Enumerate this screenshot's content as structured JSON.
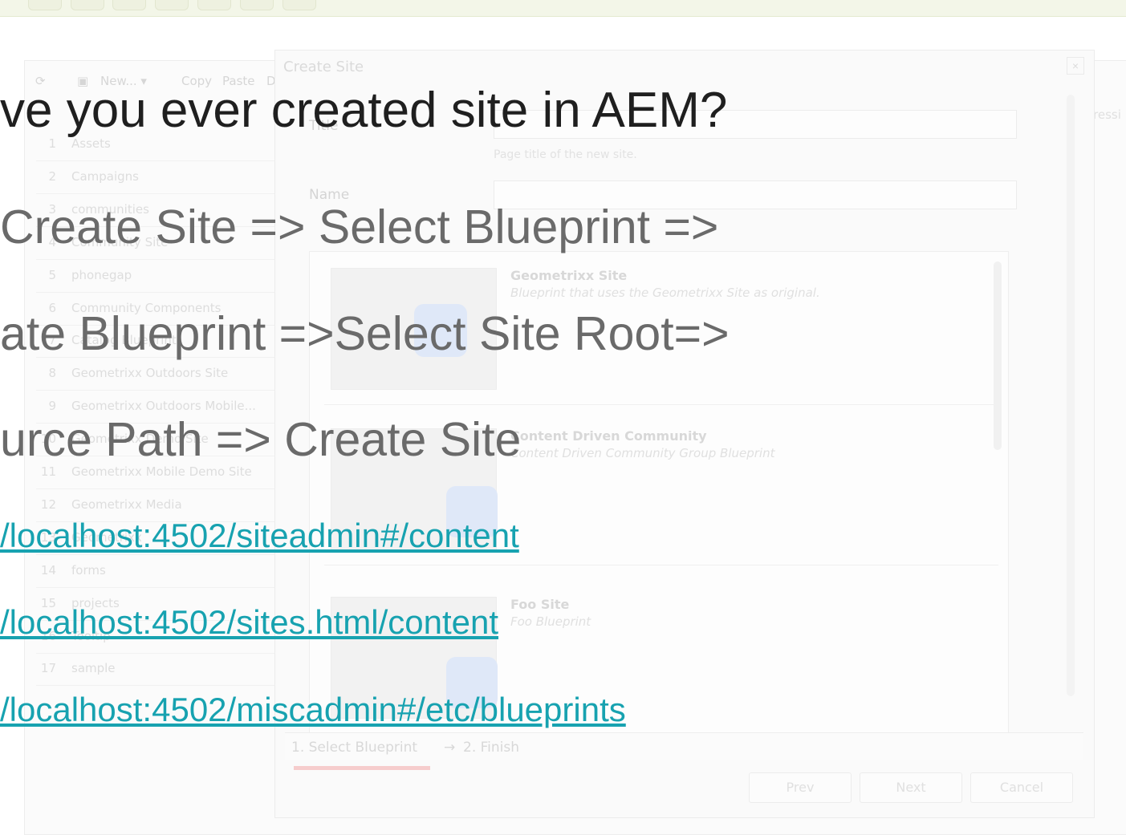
{
  "background_ui": {
    "toolbar": {
      "new_label": "New... ▾",
      "copy_label": "Copy",
      "paste_label": "Paste",
      "extra": "D"
    },
    "tree": [
      {
        "num": "1",
        "label": "Assets"
      },
      {
        "num": "2",
        "label": "Campaigns"
      },
      {
        "num": "3",
        "label": "communities"
      },
      {
        "num": "4",
        "label": "Community Site"
      },
      {
        "num": "5",
        "label": "phonegap"
      },
      {
        "num": "6",
        "label": "Community Components"
      },
      {
        "num": "7",
        "label": "Catalog Blueprint"
      },
      {
        "num": "8",
        "label": "Geometrixx Outdoors Site"
      },
      {
        "num": "9",
        "label": "Geometrixx Outdoors Mobile..."
      },
      {
        "num": "10",
        "label": "Geometrixx Demo Site"
      },
      {
        "num": "11",
        "label": "Geometrixx Mobile Demo Site"
      },
      {
        "num": "12",
        "label": "Geometrixx Media"
      },
      {
        "num": "13",
        "label": "Geometrixx"
      },
      {
        "num": "14",
        "label": "forms"
      },
      {
        "num": "15",
        "label": "projects"
      },
      {
        "num": "16",
        "label": "Tooltip"
      },
      {
        "num": "17",
        "label": "sample"
      }
    ],
    "right_header": "ressi",
    "dialog": {
      "title": "Create Site",
      "close_glyph": "×",
      "title_label": "Title",
      "title_hint": "Page title of the new site.",
      "name_label": "Name",
      "blueprints": [
        {
          "name": "Geometrixx Site",
          "desc": "Blueprint that uses the Geometrixx Site as original."
        },
        {
          "name": "Content Driven Community",
          "desc": "Content Driven Community Group Blueprint"
        },
        {
          "name": "Foo Site",
          "desc": "Foo Blueprint"
        }
      ],
      "wizard_step1": "1. Select Blueprint",
      "wizard_arrow": "→",
      "wizard_step2": "2. Finish",
      "prev_label": "Prev",
      "next_label": "Next",
      "cancel_label": "Cancel"
    }
  },
  "slide": {
    "title": "ve you ever created site in AEM?",
    "step1": "Create Site => Select Blueprint =>",
    "step2": "ate Blueprint =>Select Site Root=>",
    "step3": "urce Path => Create Site",
    "links": [
      "/localhost:4502/siteadmin#/content",
      "/localhost:4502/sites.html/content",
      "/localhost:4502/miscadmin#/etc/blueprints"
    ]
  }
}
